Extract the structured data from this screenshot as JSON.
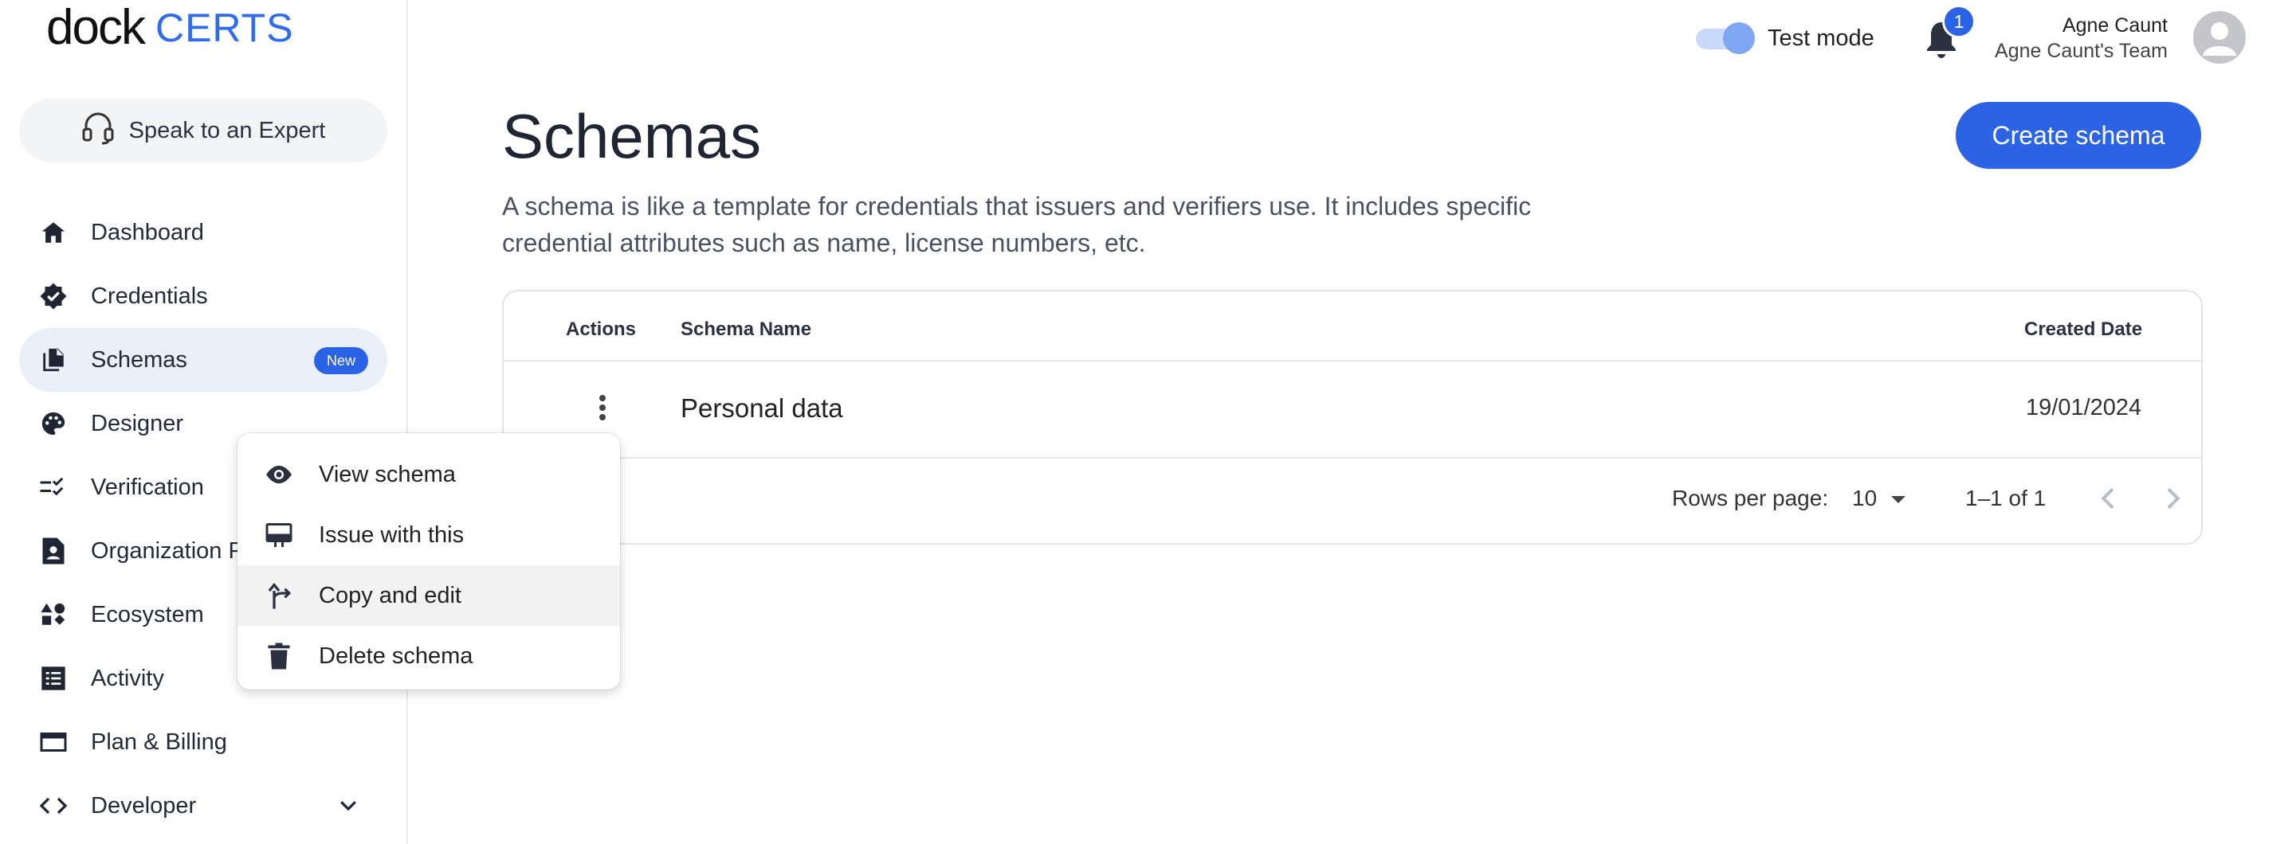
{
  "brand": {
    "logo_primary": "dock",
    "logo_secondary": "CERTS",
    "accent": "#2a63e6"
  },
  "sidebar": {
    "expert_button": "Speak to an Expert",
    "items": [
      {
        "label": "Dashboard",
        "icon": "home-icon"
      },
      {
        "label": "Credentials",
        "icon": "verified-badge-icon"
      },
      {
        "label": "Schemas",
        "icon": "documents-icon",
        "badge": "New",
        "active": true
      },
      {
        "label": "Designer",
        "icon": "palette-icon"
      },
      {
        "label": "Verification",
        "icon": "checklist-icon"
      },
      {
        "label": "Organization P",
        "icon": "profile-document-icon"
      },
      {
        "label": "Ecosystem",
        "icon": "shapes-icon"
      },
      {
        "label": "Activity",
        "icon": "list-icon"
      },
      {
        "label": "Plan & Billing",
        "icon": "card-icon"
      },
      {
        "label": "Developer",
        "icon": "code-icon"
      }
    ]
  },
  "topbar": {
    "test_mode_label": "Test mode",
    "notification_count": "1",
    "user_name": "Agne Caunt",
    "user_team": "Agne Caunt's Team"
  },
  "main": {
    "title": "Schemas",
    "create_button": "Create schema",
    "description": "A schema is like a template for credentials that issuers and verifiers use. It includes specific credential attributes such as name, license numbers, etc.",
    "table": {
      "headers": {
        "actions": "Actions",
        "name": "Schema Name",
        "created": "Created Date"
      },
      "rows": [
        {
          "name": "Personal data",
          "created": "19/01/2024"
        }
      ],
      "footer": {
        "rows_per_page_label": "Rows per page:",
        "rows_per_page_value": "10",
        "range": "1–1 of 1"
      }
    }
  },
  "context_menu": {
    "items": [
      {
        "label": "View schema",
        "icon": "eye-icon"
      },
      {
        "label": "Issue with this",
        "icon": "issue-icon"
      },
      {
        "label": "Copy and edit",
        "icon": "fork-icon"
      },
      {
        "label": "Delete schema",
        "icon": "trash-icon"
      }
    ]
  }
}
